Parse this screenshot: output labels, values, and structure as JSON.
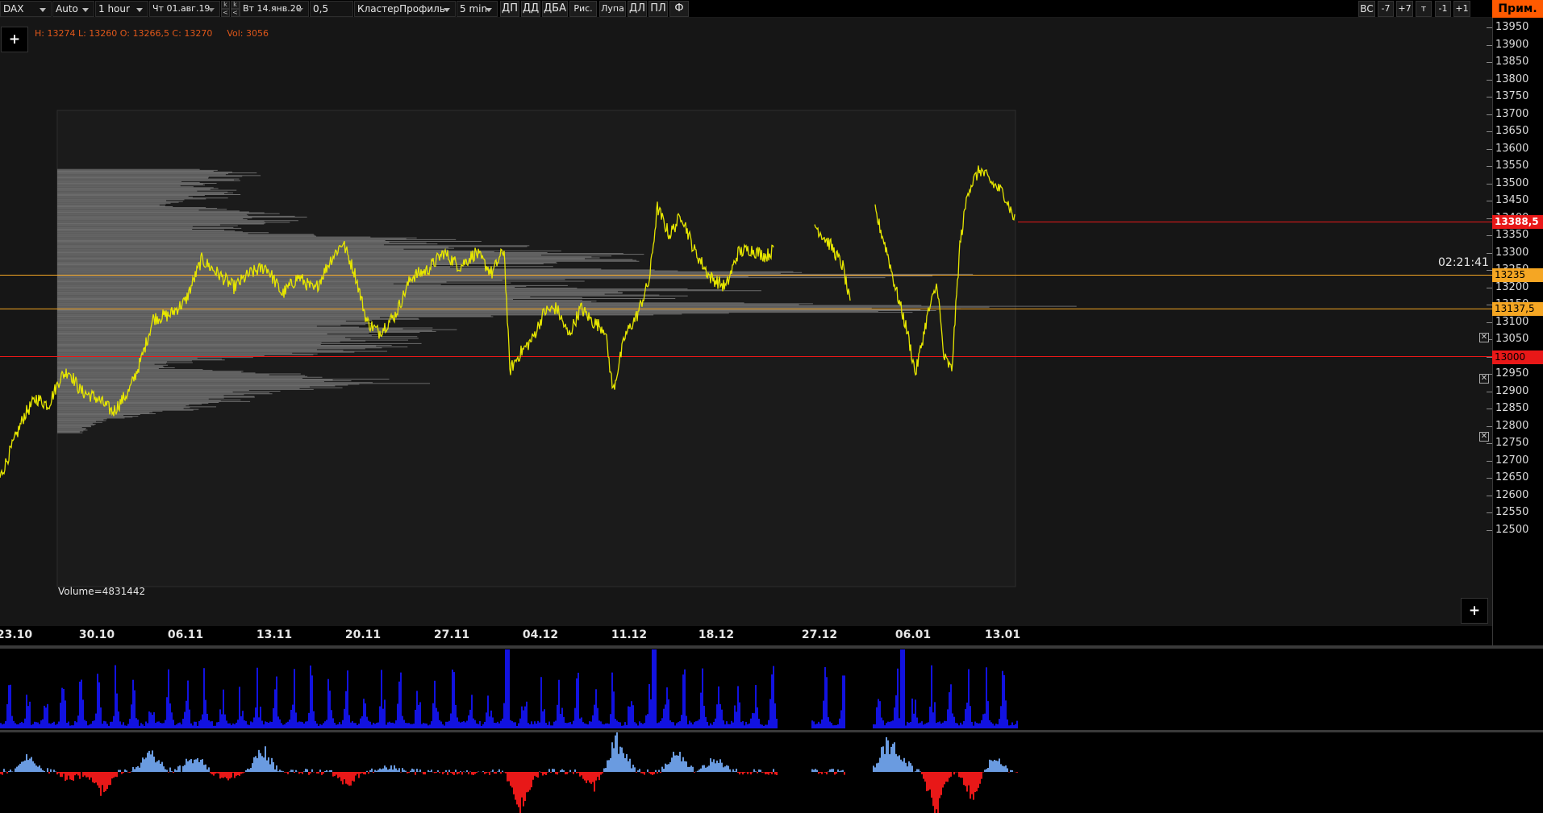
{
  "toolbar": {
    "symbol": "DAX",
    "scale_mode": "Auto",
    "timeframe": "1 hour",
    "date_from": "Чт 01.авг.19",
    "date_to": "Вт 14.янв.20",
    "tick_size": "0,5",
    "chart_type": "КластерПрофиль",
    "cluster_period": "5 min",
    "nav_up": "k",
    "nav_left": "<",
    "nav_up2": "k",
    "nav_left2": "<",
    "buttons": [
      "ДП",
      "ДД",
      "ДБА",
      "Рис.",
      "Лупа",
      "ДЛ",
      "ПЛ",
      "Ф"
    ],
    "right_buttons": [
      "ВС",
      "-7",
      "+7",
      "т",
      "-1",
      "+1"
    ],
    "prim_label": "Прим."
  },
  "ohlc_info": {
    "text": "H: 13274  L: 13260  O: 13266,5  C: 13270",
    "volume": "Vol: 3056"
  },
  "chart": {
    "add_button_label": "+",
    "add_button_bottom_label": "+",
    "volume_label": "Volume=4831442",
    "timer": "02:21:41",
    "current_price": "13388,5",
    "levels": [
      {
        "price": "13235",
        "color": "#f5a623"
      },
      {
        "price": "13137,5",
        "color": "#f5a623"
      },
      {
        "price": "13000",
        "color": "#e81818"
      }
    ],
    "level_close_icon": "✕",
    "price_ticks": [
      "13950",
      "13900",
      "13850",
      "13800",
      "13750",
      "13700",
      "13650",
      "13600",
      "13550",
      "13500",
      "13450",
      "13400",
      "13350",
      "13300",
      "13250",
      "13200",
      "13150",
      "13100",
      "13050",
      "13000",
      "12950",
      "12900",
      "12850",
      "12800",
      "12750",
      "12700",
      "12650",
      "12600",
      "12550",
      "12500"
    ],
    "date_ticks": [
      "23.10",
      "30.10",
      "06.11",
      "13.11",
      "20.11",
      "27.11",
      "04.12",
      "11.12",
      "18.12",
      "27.12",
      "06.01",
      "13.01"
    ],
    "price_line_color": "#e6e600",
    "profile_color": "#7a7a7a",
    "volume_color": "#1212e0",
    "delta_positive_color": "#6a9be0",
    "delta_negative_color": "#e81818",
    "current_price_color": "#e81818"
  }
}
